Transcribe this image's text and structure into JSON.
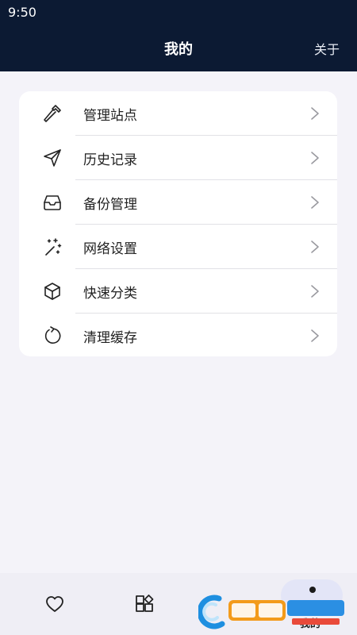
{
  "status_bar": {
    "time": "9:50"
  },
  "header": {
    "title": "我的",
    "about_label": "关于"
  },
  "menu": {
    "items": [
      {
        "label": "管理站点",
        "icon": "hammer-icon"
      },
      {
        "label": "历史记录",
        "icon": "send-icon"
      },
      {
        "label": "备份管理",
        "icon": "inbox-icon"
      },
      {
        "label": "网络设置",
        "icon": "sparkles-icon"
      },
      {
        "label": "快速分类",
        "icon": "cube-icon"
      },
      {
        "label": "清理缓存",
        "icon": "refresh-icon"
      }
    ]
  },
  "tab_bar": {
    "active_label": "我的",
    "tabs": [
      {
        "icon": "heart-icon"
      },
      {
        "icon": "grid-icon"
      },
      {
        "icon": "person-icon",
        "label": "我的",
        "active": true
      }
    ]
  },
  "colors": {
    "header_bg": "#0c1a33",
    "page_bg": "#f4f3f9",
    "card_bg": "#ffffff",
    "active_tab_bg": "#e3e5f7"
  }
}
